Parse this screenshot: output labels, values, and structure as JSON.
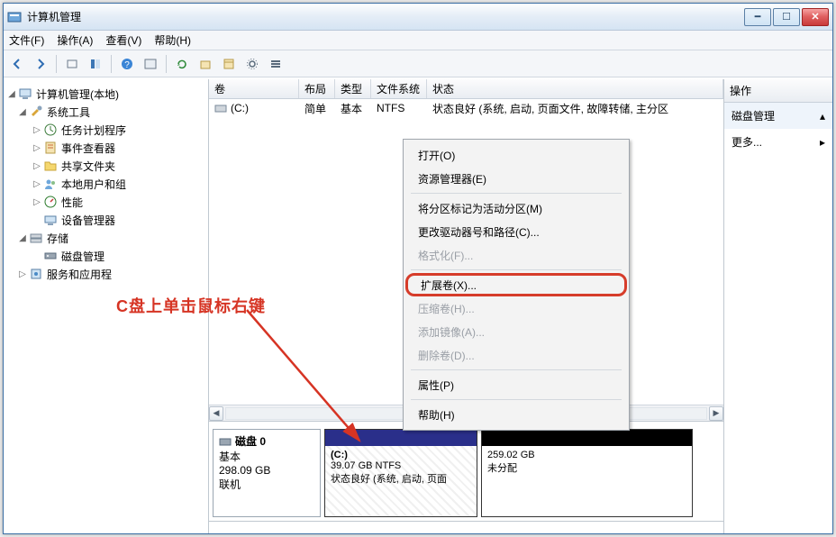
{
  "title": "计算机管理",
  "menu": {
    "file": "文件(F)",
    "action": "操作(A)",
    "view": "查看(V)",
    "help": "帮助(H)"
  },
  "tree": {
    "root": "计算机管理(本地)",
    "systools": "系统工具",
    "t1": "任务计划程序",
    "t2": "事件查看器",
    "t3": "共享文件夹",
    "t4": "本地用户和组",
    "t5": "性能",
    "t6": "设备管理器",
    "storage": "存储",
    "disk": "磁盘管理",
    "svc": "服务和应用程"
  },
  "grid": {
    "h1": "卷",
    "h2": "布局",
    "h3": "类型",
    "h4": "文件系统",
    "h5": "状态",
    "r1c1": "(C:)",
    "r1c2": "简单",
    "r1c3": "基本",
    "r1c4": "NTFS",
    "r1c5": "状态良好 (系统, 启动, 页面文件, 故障转储, 主分区"
  },
  "ctx": {
    "m1": "打开(O)",
    "m2": "资源管理器(E)",
    "m3": "将分区标记为活动分区(M)",
    "m4": "更改驱动器号和路径(C)...",
    "m5": "格式化(F)...",
    "m6": "扩展卷(X)...",
    "m7": "压缩卷(H)...",
    "m8": "添加镜像(A)...",
    "m9": "删除卷(D)...",
    "m10": "属性(P)",
    "m11": "帮助(H)"
  },
  "disk": {
    "name": "磁盘 0",
    "type": "基本",
    "cap": "298.09 GB",
    "state": "联机",
    "c_label": "(C:)",
    "c_info": "39.07 GB NTFS",
    "c_status": "状态良好 (系统, 启动, 页面",
    "u_info": "259.02 GB",
    "u_status": "未分配"
  },
  "actions": {
    "hdr": "操作",
    "a1": "磁盘管理",
    "a2": "更多..."
  },
  "annotation": "C盘上单击鼠标右键"
}
